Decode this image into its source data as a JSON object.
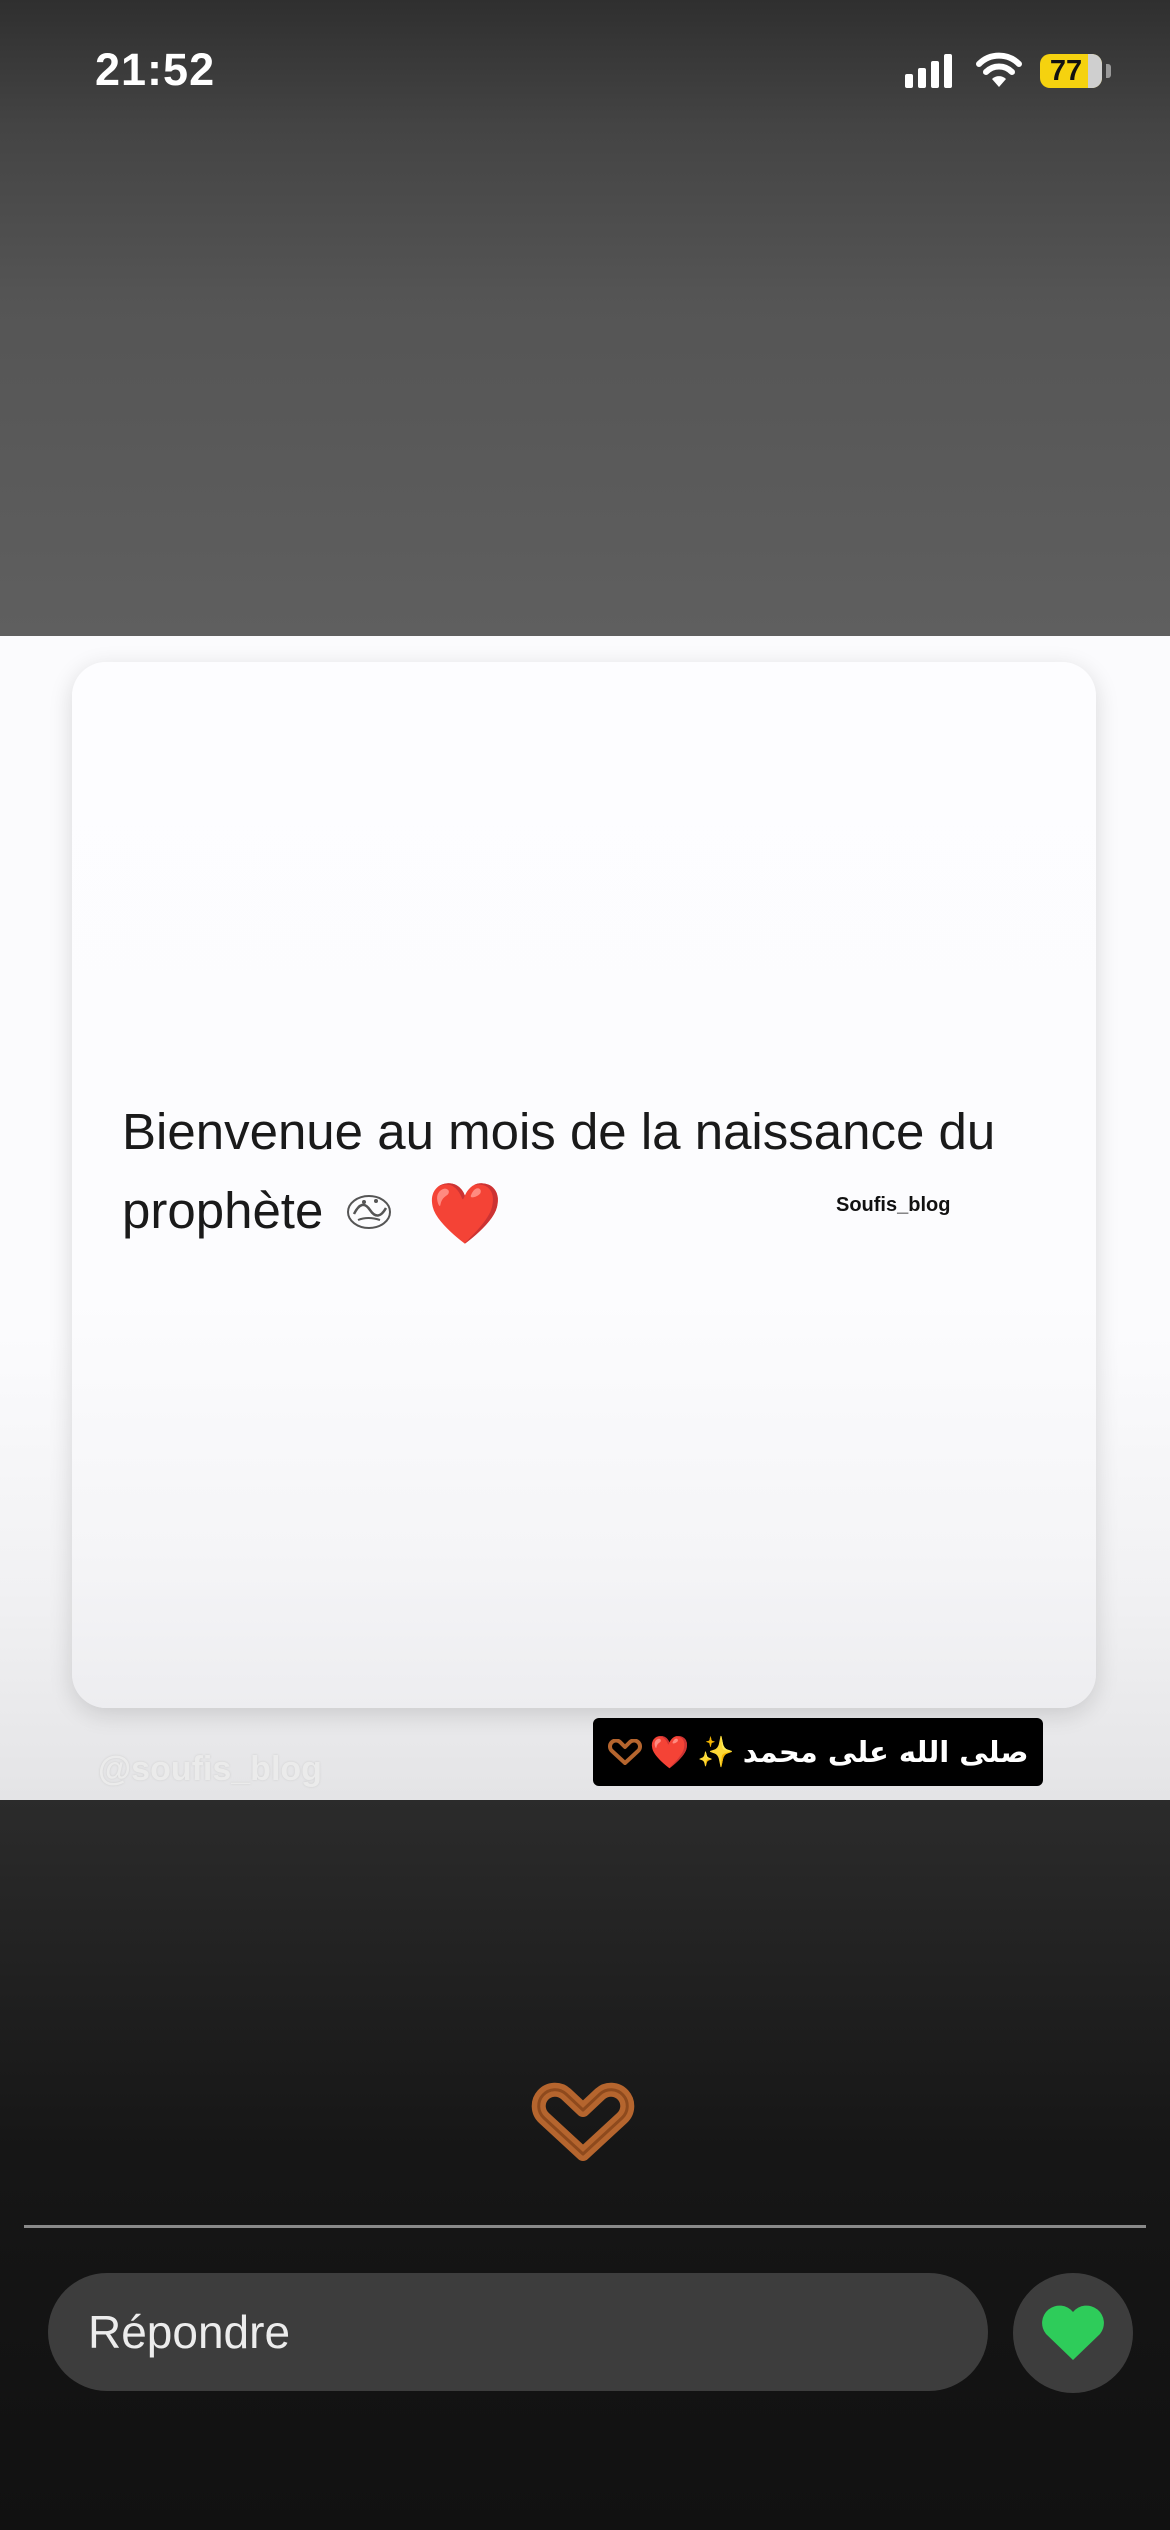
{
  "status_bar": {
    "time": "21:52",
    "battery_level": "77",
    "battery_color": "#f5d20f",
    "icons": [
      "cellular-signal-icon",
      "wifi-icon",
      "battery-icon"
    ]
  },
  "story": {
    "caption": "Bienvenue au mois de la naissance du prophète",
    "caption_emoji": "❤️",
    "caption_watermark": "Soufis_blog",
    "handle_watermark": "@soufis_blog",
    "arabic_sticker": {
      "text": "صلى الله على محمد",
      "sparkle": "✨",
      "heart": "❤️"
    },
    "reaction_icon": "heart-hands-icon"
  },
  "reply_bar": {
    "placeholder": "Répondre",
    "like_icon": "heart-icon",
    "like_color": "#2ecc5a"
  }
}
